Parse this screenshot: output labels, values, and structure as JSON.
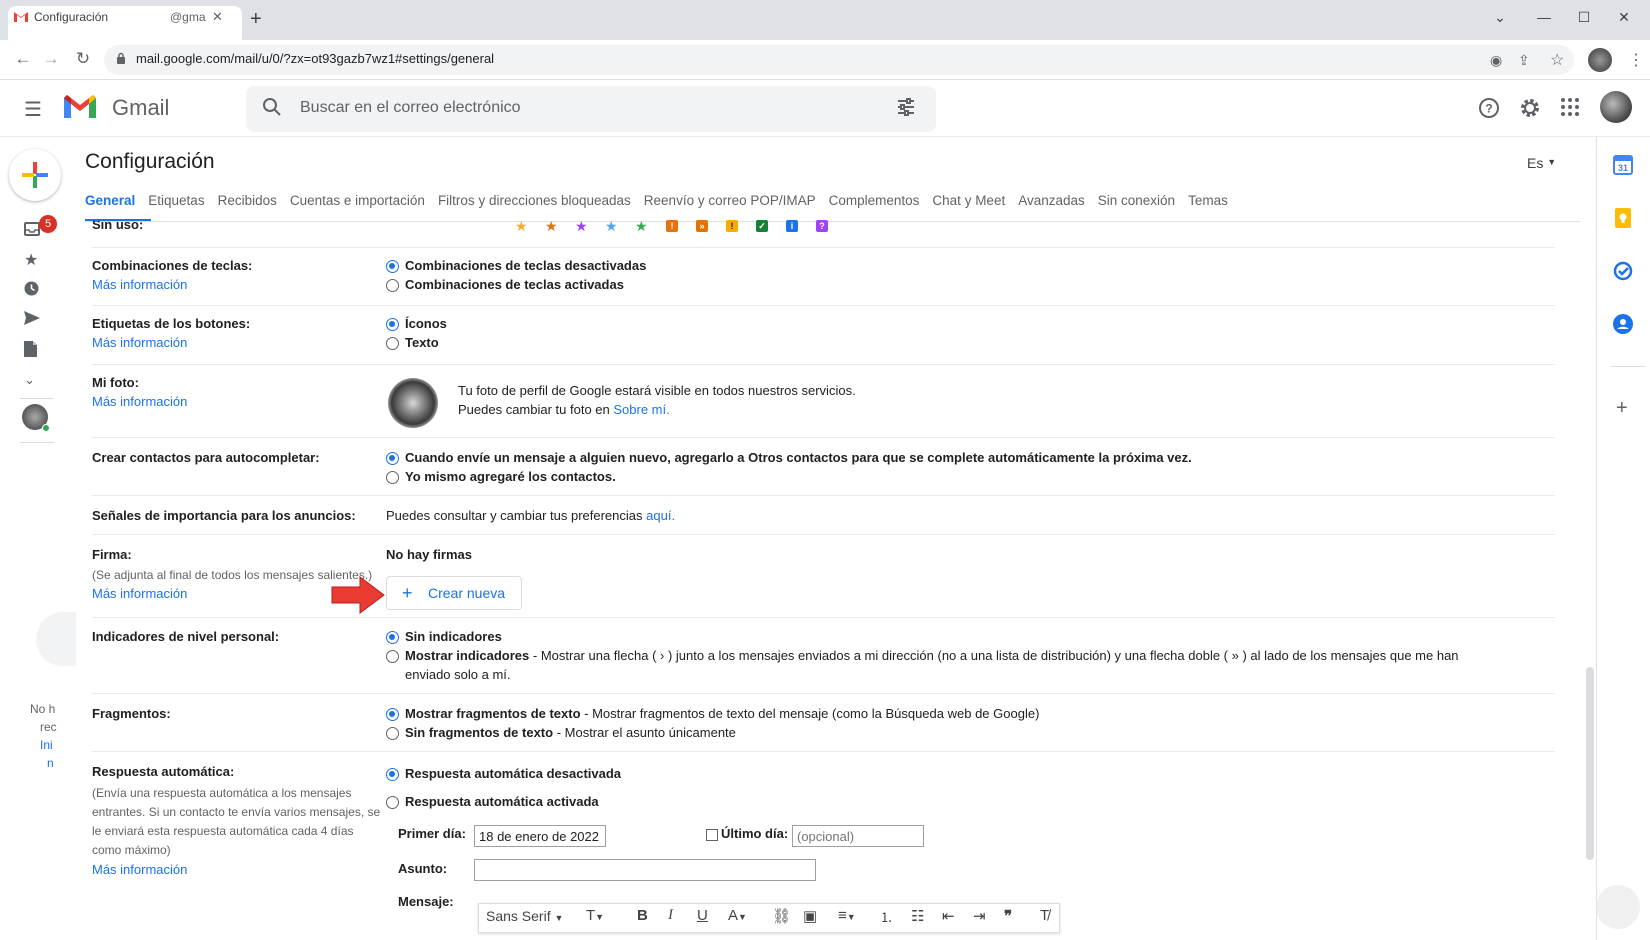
{
  "browser": {
    "tab_title": "Configuración",
    "tab_account": "@gma",
    "url": "mail.google.com/mail/u/0/?zx=ot93gazb7wz1#settings/general"
  },
  "header": {
    "brand": "Gmail",
    "search_placeholder": "Buscar en el correo electrónico"
  },
  "rail": {
    "inbox_badge": "5",
    "side_text": [
      "No h",
      "rec",
      "Ini",
      "n"
    ]
  },
  "page": {
    "title": "Configuración",
    "lang_button": "Es",
    "tabs": [
      "General",
      "Etiquetas",
      "Recibidos",
      "Cuentas e importación",
      "Filtros y direcciones bloqueadas",
      "Reenvío y correo POP/IMAP",
      "Complementos",
      "Chat y Meet",
      "Avanzadas",
      "Sin conexión",
      "Temas"
    ]
  },
  "settings": {
    "more_info": "Más información",
    "stars_label": "Sin uso:",
    "keyboard": {
      "label": "Combinaciones de teclas:",
      "opt1": "Combinaciones de teclas desactivadas",
      "opt2": "Combinaciones de teclas activadas"
    },
    "button_labels": {
      "label": "Etiquetas de los botones:",
      "opt1": "Íconos",
      "opt2": "Texto"
    },
    "photo": {
      "label": "Mi foto:",
      "line1": "Tu foto de perfil de Google estará visible en todos nuestros servicios.",
      "line2": "Puedes cambiar tu foto en ",
      "link": "Sobre mí."
    },
    "contacts": {
      "label": "Crear contactos para autocompletar:",
      "opt1": "Cuando envíe un mensaje a alguien nuevo, agregarlo a Otros contactos para que se complete automáticamente la próxima vez.",
      "opt2": "Yo mismo agregaré los contactos."
    },
    "ads": {
      "label": "Señales de importancia para los anuncios:",
      "text": "Puedes consultar y cambiar tus preferencias ",
      "link": "aquí."
    },
    "signature": {
      "label": "Firma:",
      "note": "(Se adjunta al final de todos los mensajes salientes.)",
      "none": "No hay firmas",
      "create": "Crear nueva"
    },
    "personal": {
      "label": "Indicadores de nivel personal:",
      "opt1": "Sin indicadores",
      "opt2_bold": "Mostrar indicadores",
      "opt2_rest": " - Mostrar una flecha ( › ) junto a los mensajes enviados a mi dirección (no a una lista de distribución) y una flecha doble ( » ) al lado de los mensajes que me han",
      "opt2_line2": "enviado solo a mí."
    },
    "snippets": {
      "label": "Fragmentos:",
      "opt1_bold": "Mostrar fragmentos de texto",
      "opt1_rest": " - Mostrar fragmentos de texto del mensaje (como la Búsqueda web de Google)",
      "opt2_bold": "Sin fragmentos de texto",
      "opt2_rest": " - Mostrar el asunto únicamente"
    },
    "autoreply": {
      "label": "Respuesta automática:",
      "note": "(Envía una respuesta automática a los mensajes entrantes. Si un contacto te envía varios mensajes, se le enviará esta respuesta automática cada 4 días como máximo)",
      "opt1": "Respuesta automática desactivada",
      "opt2": "Respuesta automática activada",
      "first_day_label": "Primer día:",
      "first_day_value": "18 de enero de 2022",
      "last_day_label": "Último día:",
      "last_day_placeholder": "(opcional)",
      "subject_label": "Asunto:",
      "message_label": "Mensaje:",
      "font": "Sans Serif"
    }
  }
}
